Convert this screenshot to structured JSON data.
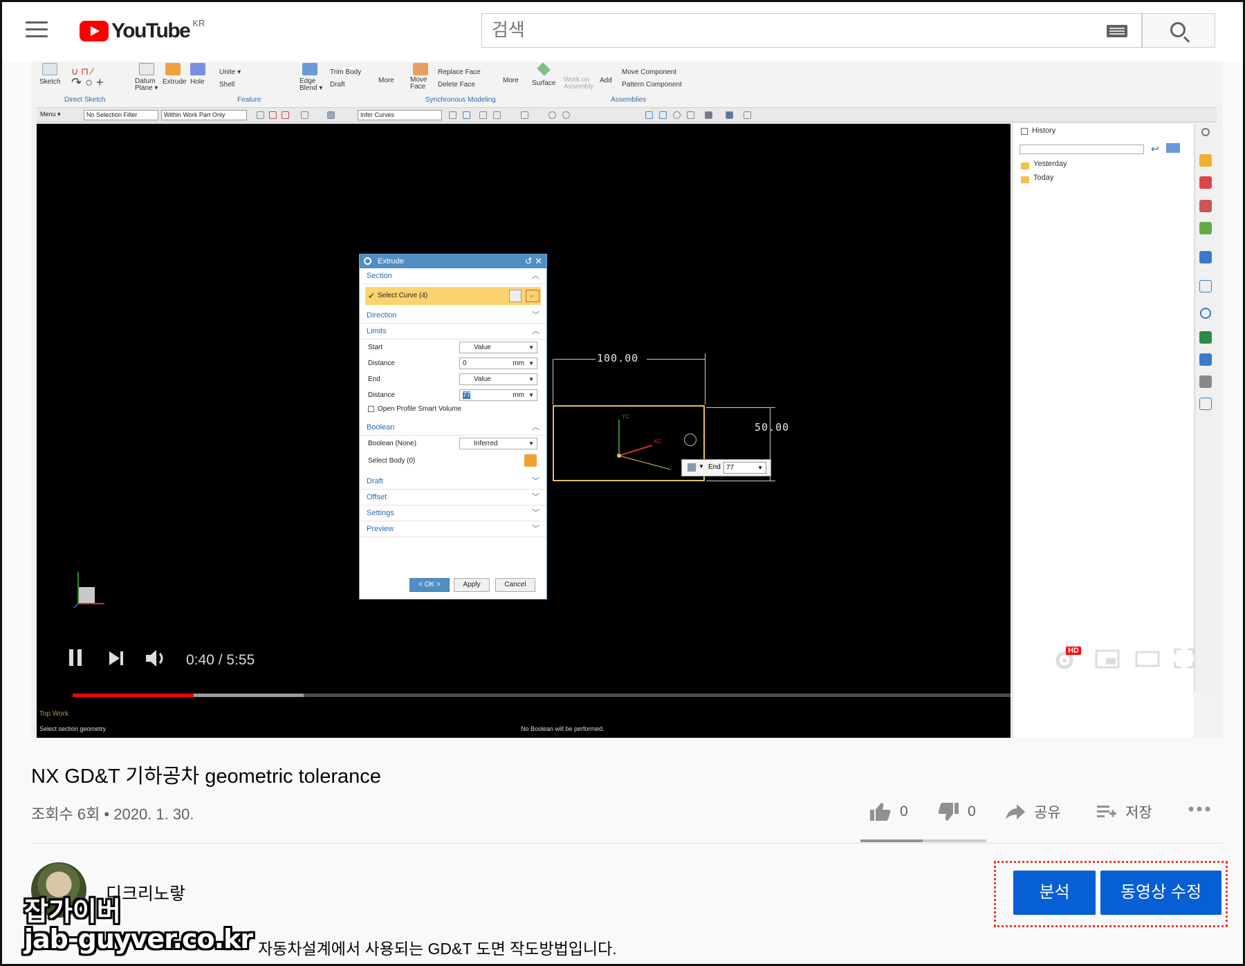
{
  "header": {
    "logo_text": "YouTube",
    "logo_region": "KR",
    "search_placeholder": "검색"
  },
  "nx": {
    "ribbon": {
      "items": [
        "Sketch",
        "Datum Plane ▾",
        "Extrude",
        "Hole",
        "Unite ▾",
        "Shell",
        "Edge Blend ▾",
        "Trim Body",
        "Draft",
        "More",
        "Move Face",
        "Replace Face",
        "Delete Face",
        "More",
        "Surface",
        "Work on Assembly",
        "Add",
        "Move Component",
        "Pattern Component"
      ],
      "groups": [
        "Direct Sketch",
        "Feature",
        "Synchronous Modeling",
        "Assemblies"
      ]
    },
    "toolbar": {
      "menu": "Menu ▾",
      "selection_filter": "No Selection Filter",
      "scope": "Within Work Part Only",
      "curve_rule": "Infer Curves"
    },
    "history": {
      "title": "History",
      "items": [
        "Yesterday",
        "Today"
      ]
    },
    "extrude": {
      "title": "Extrude",
      "section": "Section",
      "select_curve": "Select Curve (4)",
      "direction": "Direction",
      "limits": "Limits",
      "start_label": "Start",
      "start_value": "Value",
      "distance_label": "Distance",
      "start_distance": "0",
      "unit": "mm",
      "end_label": "End",
      "end_value": "Value",
      "end_distance": "77",
      "open_profile": "Open Profile Smart Volume",
      "boolean": "Boolean",
      "boolean_label": "Boolean (None)",
      "boolean_value": "Inferred",
      "select_body": "Select Body (0)",
      "draft": "Draft",
      "offset": "Offset",
      "settings": "Settings",
      "preview": "Preview",
      "ok": "< OK >",
      "apply": "Apply",
      "cancel": "Cancel"
    },
    "sketch": {
      "width_dim": "100.00",
      "height_dim": "50.00",
      "end_label": "End",
      "end_value": "77",
      "axis_y": "YC",
      "axis_x": "XC"
    },
    "status": {
      "left_top": "Top Work",
      "left_bottom": "Select section geometry",
      "center": "No Boolean will be performed."
    }
  },
  "player": {
    "time": "0:40 / 5:55",
    "played_fraction": 0.11,
    "buffered_fraction": 0.21,
    "hd_badge": "HD"
  },
  "video": {
    "title": "NX GD&T 기하공차 geometric tolerance",
    "meta": "조회수 6회 • 2020. 1. 30.",
    "likes": "0",
    "dislikes": "0",
    "share": "공유",
    "save": "저장"
  },
  "channel": {
    "name": "디크리노랗",
    "description": "자동차설계에서 사용되는 GD&T 도면 작도방법입니다."
  },
  "studio_buttons": {
    "analytics": "분석",
    "edit_video": "동영상 수정"
  },
  "watermark": {
    "line1": "잡가이버",
    "line2": "jab-guyver.co.kr"
  },
  "colors": {
    "youtube_red": "#ff0000",
    "studio_blue": "#065fd4",
    "highlight_red": "#e53935",
    "nx_dialog_header": "#4f8fc4",
    "sketch_yellow": "#e6c25a"
  }
}
